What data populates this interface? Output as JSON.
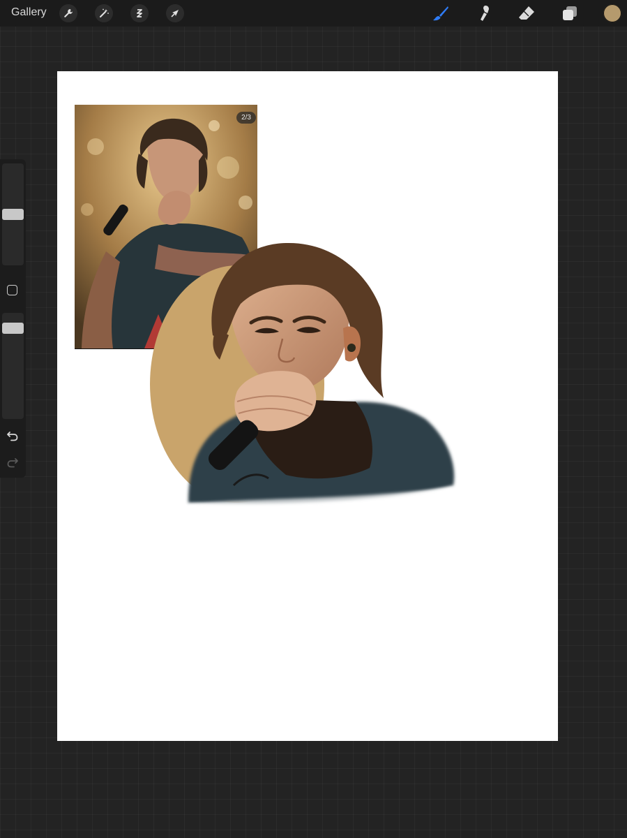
{
  "toolbar": {
    "gallery_label": "Gallery",
    "left_tools": [
      "wrench-icon",
      "magic-wand-icon",
      "selection-icon",
      "transform-arrow-icon"
    ],
    "right_tools": [
      "brush-icon",
      "smudge-icon",
      "eraser-icon",
      "layers-icon"
    ],
    "active_tool": "brush-icon",
    "active_color": "#b59a6d",
    "brush_highlight": "#2f7cf6"
  },
  "reference": {
    "page_indicator": "2/3"
  },
  "sidebar": {
    "brush_size_level": 0.5,
    "opacity_level": 0.9
  }
}
